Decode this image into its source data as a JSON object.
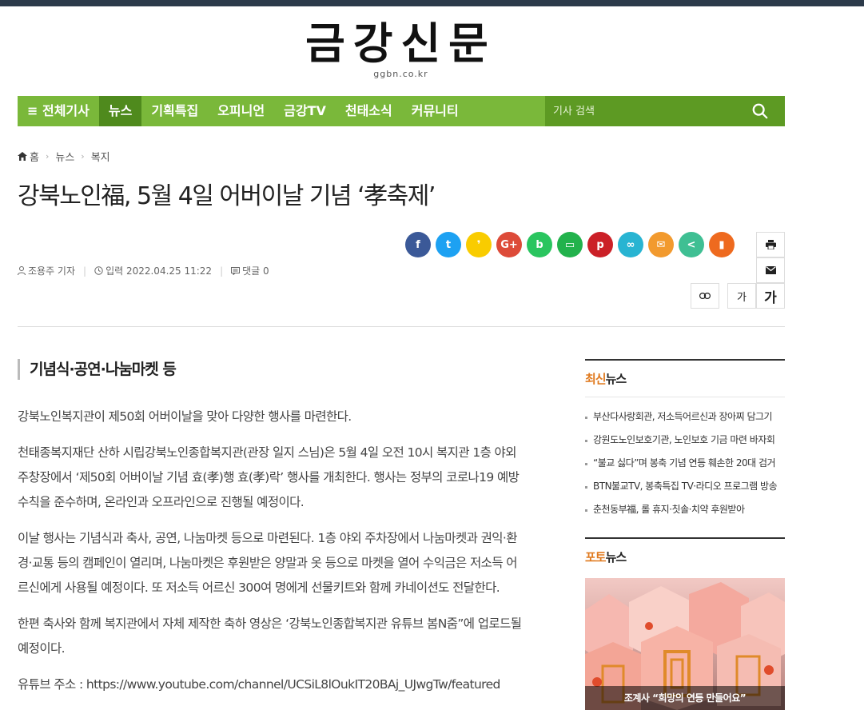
{
  "header": {
    "logo_title": "금강신문",
    "logo_domain": "ggbn.co.kr"
  },
  "nav": {
    "all_label": "≡ 전체기사",
    "items": [
      "뉴스",
      "기획특집",
      "오피니언",
      "금강TV",
      "천태소식",
      "커뮤니티"
    ],
    "active_index": 0,
    "search_placeholder": "기사 검색"
  },
  "breadcrumb": {
    "home": "홈",
    "level1": "뉴스",
    "level2": "복지"
  },
  "article": {
    "title": "강북노인福, 5월 4일 어버이날 기념 ‘孝축제’",
    "reporter": "조용주 기자",
    "date": "입력 2022.04.25 11:22",
    "comments": "댓글 0",
    "subheading": "기념식·공연·나눔마켓 등",
    "paragraphs": [
      "강북노인복지관이 제50회 어버이날을 맞아 다양한 행사를 마련한다.",
      "천태종복지재단 산하 시립강북노인종합복지관(관장 일지 스님)은 5월 4일 오전 10시 복지관 1층 야외 주창장에서 ‘제50회 어버이날 기념 효(孝)행 효(孝)락’ 행사를 개최한다. 행사는 정부의 코로나19 예방수칙을 준수하며, 온라인과 오프라인으로 진행될 예정이다.",
      "이날 행사는 기념식과 축사, 공연, 나눔마켓 등으로 마련된다. 1층 야외 주차장에서 나눔마켓과 권익·환경·교통 등의 캠페인이 열리며, 나눔마켓은 후원받은 양말과 옷 등으로 마켓을 열어 수익금은 저소득 어르신에게 사용될 예정이다. 또 저소득 어르신 300여 명에게 선물키트와 함께 카네이션도 전달한다.",
      "한편 축사와 함께 복지관에서 자체 제작한 축하 영상은 ‘강북노인종합복지관 유튜브 봄N줌”에 업로드될 예정이다.",
      "유튜브 주소 : https://www.youtube.com/channel/UCSiL8lOukIT20BAj_UJwgTw/featured"
    ]
  },
  "share_buttons": [
    {
      "name": "facebook-share-button",
      "glyph": "f",
      "color": "#3b5998"
    },
    {
      "name": "twitter-share-button",
      "glyph": "t",
      "color": "#1da1f2"
    },
    {
      "name": "kakaostory-share-button",
      "glyph": "❜",
      "color": "#f9cc00"
    },
    {
      "name": "googleplus-share-button",
      "glyph": "G+",
      "color": "#dd4b39"
    },
    {
      "name": "band-share-button",
      "glyph": "b",
      "color": "#2ac55f"
    },
    {
      "name": "line-share-button",
      "glyph": "▭",
      "color": "#22b24c"
    },
    {
      "name": "pinterest-share-button",
      "glyph": "p",
      "color": "#cb2027"
    },
    {
      "name": "link-share-button",
      "glyph": "∞",
      "color": "#28b4d2"
    },
    {
      "name": "email-share-button",
      "glyph": "✉",
      "color": "#f29a2e"
    },
    {
      "name": "more-share-button",
      "glyph": "<",
      "color": "#3fbf93"
    },
    {
      "name": "bookmark-button",
      "glyph": "▮",
      "color": "#ee6a1f"
    }
  ],
  "tools": {
    "print_icon": "print-icon",
    "mail_icon": "mail-icon",
    "font_small": "가",
    "font_large": "가"
  },
  "sidebar": {
    "latest_hl": "최신",
    "latest_rest": "뉴스",
    "latest_items": [
      "부산다사랑회관, 저소득어르신과 장아찌 담그기",
      "강원도노인보호기관, 노인보호 기금 마련 바자회",
      "“불교 싫다”며 봉축 기념 연등 훼손한 20대 검거",
      "BTN불교TV, 봉축특집 TV·라디오 프로그램 방송",
      "춘천동부福, 롤 휴지·칫솔·치약 후원받아"
    ],
    "photo_hl": "포토",
    "photo_rest": "뉴스",
    "photo_caption": "조계사 “희망의 연등 만들어요”"
  },
  "colors": {
    "nav_green": "#7ab83a",
    "nav_active": "#4f8a1d",
    "accent_orange": "#e07a1f"
  }
}
